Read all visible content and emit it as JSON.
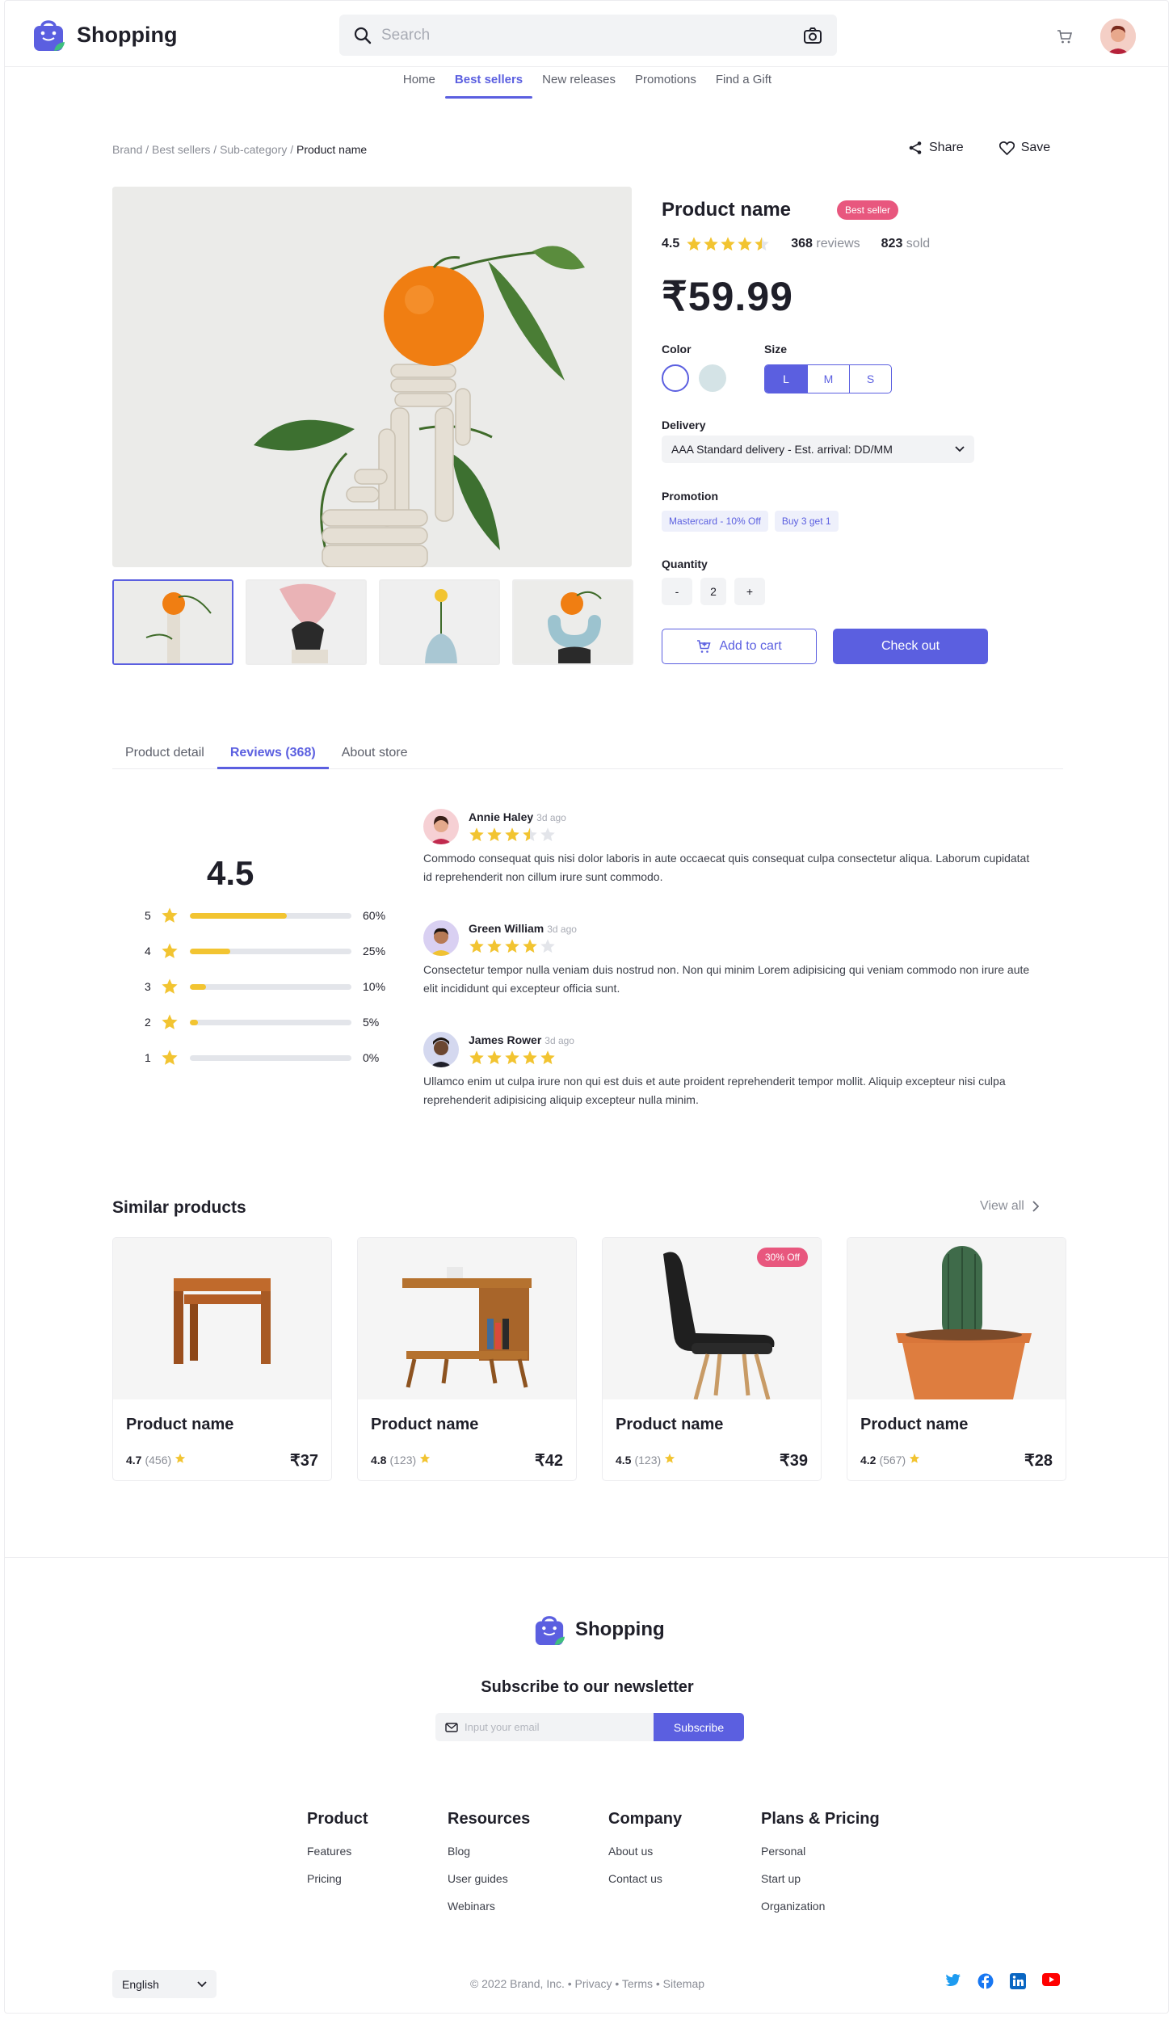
{
  "brand": {
    "name": "Shopping"
  },
  "search": {
    "placeholder": "Search"
  },
  "nav": [
    {
      "label": "Home"
    },
    {
      "label": "Best sellers",
      "active": true
    },
    {
      "label": "New releases"
    },
    {
      "label": "Promotions"
    },
    {
      "label": "Find a Gift"
    }
  ],
  "breadcrumb": {
    "c1": "Brand",
    "c2": "Best sellers",
    "c3": "Sub-category",
    "current": "Product name",
    "sep": " / "
  },
  "actions": {
    "share": "Share",
    "save": "Save"
  },
  "product": {
    "name": "Product name",
    "badge": "Best seller",
    "rating": "4.5",
    "rating_value": 4.5,
    "reviews_count": "368",
    "reviews_label": "reviews",
    "sold_count": "823",
    "sold_label": "sold",
    "price": "₹59.99",
    "color_label": "Color",
    "colors": [
      "#ffffff",
      "#d4e3e6"
    ],
    "size_label": "Size",
    "sizes": [
      "L",
      "M",
      "S"
    ],
    "selected_size": "L",
    "delivery_label": "Delivery",
    "delivery_value": "AAA Standard delivery - Est. arrival: DD/MM",
    "promotion_label": "Promotion",
    "promotions": [
      "Mastercard - 10% Off",
      "Buy 3 get 1"
    ],
    "quantity_label": "Quantity",
    "qty_minus": "-",
    "qty_value": "2",
    "qty_plus": "+",
    "add_to_cart": "Add to cart",
    "checkout": "Check out"
  },
  "tabs": [
    {
      "label": "Product detail"
    },
    {
      "label": "Reviews (368)",
      "active": true
    },
    {
      "label": "About store"
    }
  ],
  "rating_summary": {
    "average": "4.5",
    "rows": [
      {
        "stars": "5",
        "pct": "60%",
        "value": 0.6
      },
      {
        "stars": "4",
        "pct": "25%",
        "value": 0.25
      },
      {
        "stars": "3",
        "pct": "10%",
        "value": 0.1
      },
      {
        "stars": "2",
        "pct": "5%",
        "value": 0.05
      },
      {
        "stars": "1",
        "pct": "0%",
        "value": 0
      }
    ]
  },
  "reviews": [
    {
      "name": "Annie Haley",
      "ago": "3d ago",
      "stars": 3.5,
      "text": "Commodo consequat quis nisi dolor laboris in aute occaecat quis consequat culpa consectetur aliqua. Laborum cupidatat id reprehenderit non cillum irure sunt commodo."
    },
    {
      "name": "Green William",
      "ago": "3d ago",
      "stars": 4,
      "text": "Consectetur tempor nulla veniam duis nostrud non. Non qui minim Lorem adipisicing qui veniam commodo non irure aute elit incididunt qui excepteur officia sunt."
    },
    {
      "name": "James Rower",
      "ago": "3d ago",
      "stars": 5,
      "text": "Ullamco enim ut culpa irure non qui est duis et aute proident reprehenderit tempor mollit. Aliquip excepteur nisi culpa reprehenderit adipisicing aliquip excepteur nulla minim."
    }
  ],
  "similar": {
    "title": "Similar products",
    "view_all": "View all",
    "items": [
      {
        "name": "Product name",
        "rating": "4.7",
        "count": "(456)",
        "price": "₹37",
        "badge": ""
      },
      {
        "name": "Product name",
        "rating": "4.8",
        "count": "(123)",
        "price": "₹42",
        "badge": ""
      },
      {
        "name": "Product name",
        "rating": "4.5",
        "count": "(123)",
        "price": "₹39",
        "badge": "30% Off"
      },
      {
        "name": "Product name",
        "rating": "4.2",
        "count": "(567)",
        "price": "₹28",
        "badge": ""
      }
    ]
  },
  "footer": {
    "newsletter": "Subscribe to our newsletter",
    "email_placeholder": "Input your email",
    "subscribe": "Subscribe",
    "columns": [
      {
        "title": "Product",
        "links": [
          "Features",
          "Pricing"
        ]
      },
      {
        "title": "Resources",
        "links": [
          "Blog",
          "User guides",
          "Webinars"
        ]
      },
      {
        "title": "Company",
        "links": [
          "About us",
          "Contact us"
        ]
      },
      {
        "title": "Plans & Pricing",
        "links": [
          "Personal",
          "Start up",
          "Organization"
        ]
      }
    ],
    "language": "English",
    "copyright": "© 2022 Brand, Inc. • Privacy • Terms • Sitemap"
  },
  "colors": {
    "accent": "#5b5fe0",
    "star": "#f2c431",
    "badge": "#e8577e"
  }
}
